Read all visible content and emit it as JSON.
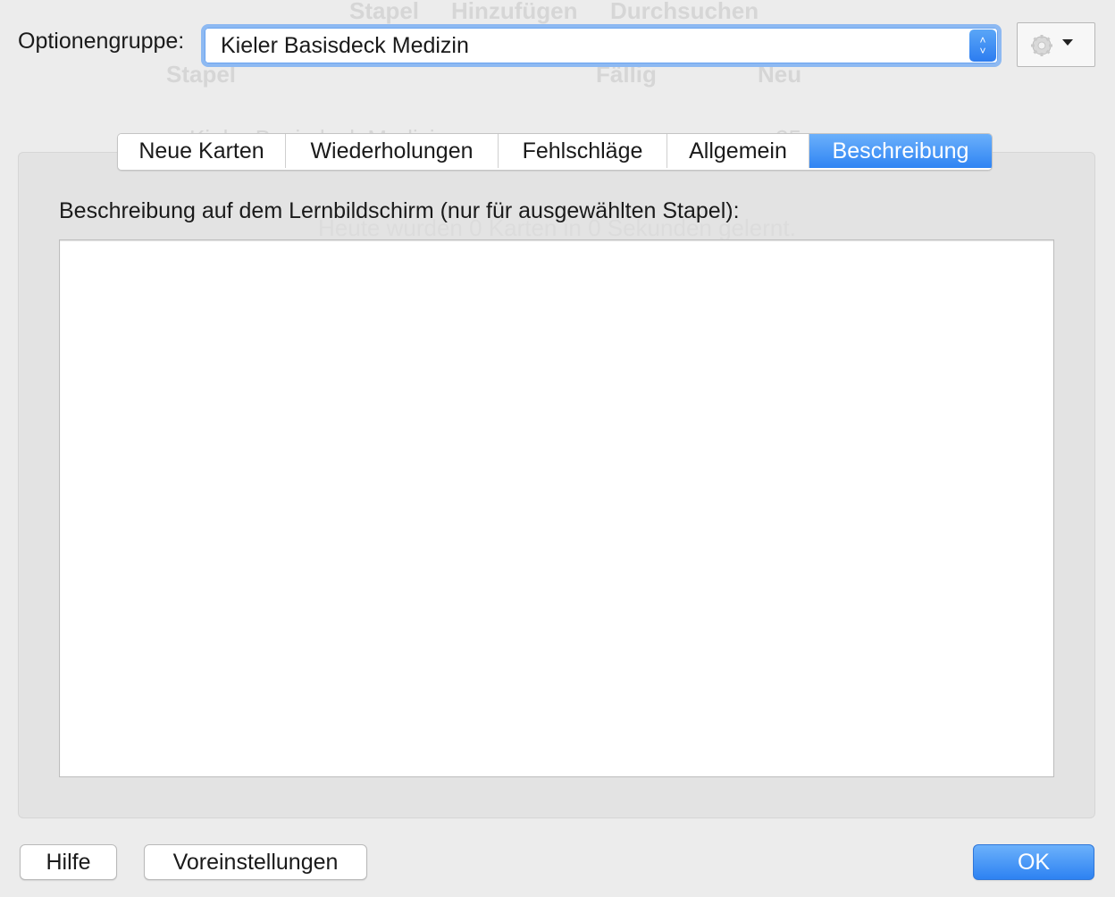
{
  "background_window": {
    "toolbar": [
      "Stapel",
      "Hinzufügen",
      "Durchsuchen"
    ],
    "columns": [
      "Stapel",
      "Fällig",
      "Neu"
    ],
    "row_deck": "Kieler Basisdeck Medizin",
    "row_count": "25",
    "studied_today": "Heute wurden 0 Karten in 0 Sekunden gelernt."
  },
  "header": {
    "group_label": "Optionengruppe:",
    "group_value": "Kieler Basisdeck Medizin",
    "gear_icon": "gear-icon",
    "gear_caret": "chevron-down-icon"
  },
  "tabs": [
    {
      "label": "Neue Karten",
      "active": false
    },
    {
      "label": "Wiederholungen",
      "active": false
    },
    {
      "label": "Fehlschläge",
      "active": false
    },
    {
      "label": "Allgemein",
      "active": false
    },
    {
      "label": "Beschreibung",
      "active": true
    }
  ],
  "description": {
    "label": "Beschreibung auf dem Lernbildschirm (nur für ausgewählten Stapel):",
    "value": ""
  },
  "footer": {
    "help_label": "Hilfe",
    "defaults_label": "Voreinstellungen",
    "ok_label": "OK"
  },
  "colors": {
    "accent": "#2f84f3",
    "focus_ring": "#8db9f2",
    "panel": "#e3e3e3",
    "window": "#ececec"
  }
}
